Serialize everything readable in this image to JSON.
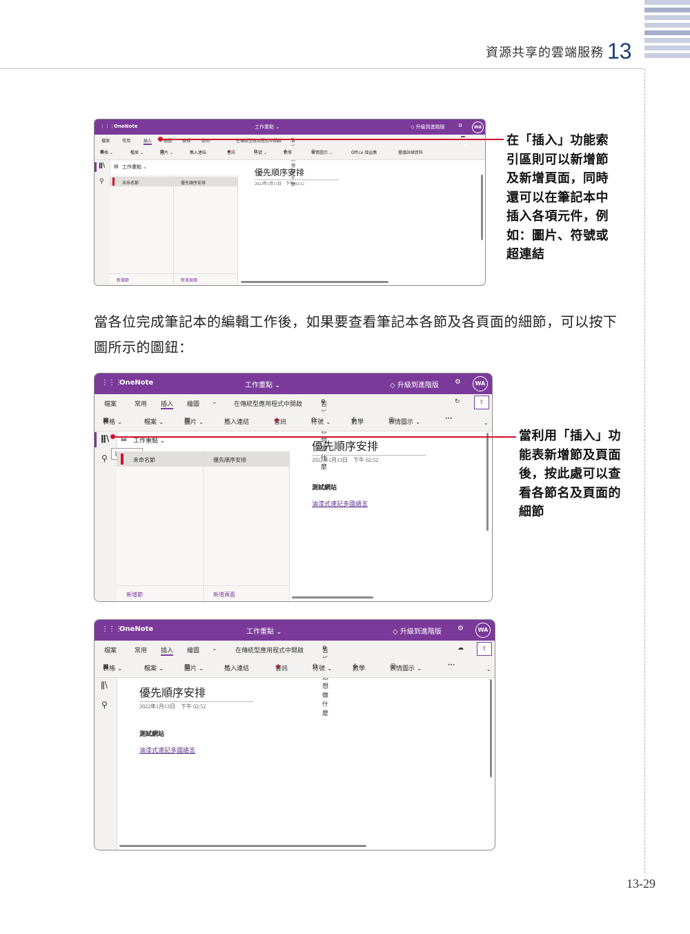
{
  "header": {
    "chapter_title": "資源共享的雲端服務",
    "chapter_number": "13"
  },
  "page_number": "13-29",
  "body_text": "當各位完成筆記本的編輯工作後，如果要查看筆記本各節及各頁面的細節，可以按下圖所示的圖鈕：",
  "callout_1": "在「插入」功能索引區則可以新增節及新增頁面，同時還可以在筆記本中插入各項元件，例如：圖片、符號或超連結",
  "callout_2": "當利用「插入」功能表新增節及頁面後，按此處可以查看各節名及頁面的細節",
  "colors": {
    "brand": "#7b3a9a",
    "callout_line": "#d0112b",
    "heading_number": "#1e3e78"
  },
  "onenote": {
    "app_name": "OneNote",
    "notebook_title": "工作重點 ⌄",
    "upgrade": "升級到進階版",
    "avatar": "WA",
    "menu": {
      "file": "檔案",
      "home": "常用",
      "insert": "插入",
      "draw": "繪圖",
      "view": "檢視",
      "help": "說明",
      "open_desktop": "在傳統型應用程式中開啟",
      "tell_me": "告訴我您想做什麼",
      "share": "共用"
    },
    "toolbar": {
      "table": "表格 ⌄",
      "file": "檔案 ⌄",
      "picture": "圖片 ⌄",
      "link": "插入連結",
      "audio": "音訊",
      "symbol": "符號 ⌄",
      "math": "數學",
      "emoji": "表情圖示 ⌄",
      "office_addins": "Office 增益集",
      "meeting": "會議詳細資料",
      "more": "···"
    },
    "nav": {
      "notebook": "工作重點 ⌄",
      "section": "未命名節",
      "page": "優先順序安排",
      "add_section": "新增節",
      "add_page": "新增頁面",
      "tooltip": "導覽導覽"
    },
    "page": {
      "title": "優先順序安排",
      "date": "2022年1月13日　下午 02:52",
      "text": "測試網站",
      "link": "油漆式速記多國語言"
    }
  }
}
